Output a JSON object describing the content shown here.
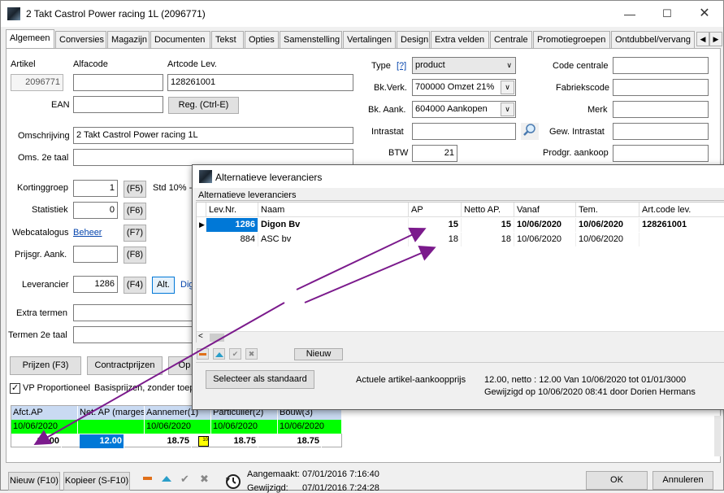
{
  "window": {
    "title": "2 Takt Castrol Power racing 1L (2096771)"
  },
  "tabs": [
    "Algemeen",
    "Conversies",
    "Magazijn",
    "Documenten",
    "Tekst",
    "Opties",
    "Samenstelling",
    "Vertalingen",
    "Design",
    "Extra velden",
    "Centrale",
    "Promotiegroepen",
    "Ontdubbel/vervang"
  ],
  "form": {
    "artikel_label": "Artikel",
    "artikel_value": "2096771",
    "alfacode_label": "Alfacode",
    "artcode_label": "Artcode Lev.",
    "artcode_value": "128261001",
    "ean_label": "EAN",
    "reg_button": "Reg. (Ctrl-E)",
    "omschrijving_label": "Omschrijving",
    "omschrijving_value": "2 Takt Castrol Power racing 1L",
    "oms2_label": "Oms. 2e taal",
    "type_label": "Type",
    "type_help": "[?]",
    "type_value": "product",
    "bkverk_label": "Bk.Verk.",
    "bkverk_value": "700000 Omzet 21%",
    "bkaank_label": "Bk. Aank.",
    "bkaank_value": "604000 Aankopen",
    "intrastat_label": "Intrastat",
    "btw_label": "BTW",
    "btw_value": "21",
    "code_centrale_label": "Code centrale",
    "fabriekscode_label": "Fabriekscode",
    "merk_label": "Merk",
    "gew_intrastat_label": "Gew. Intrastat",
    "prodgr_label": "Prodgr. aankoop",
    "kortinggroep_label": "Kortinggroep",
    "kortinggroep_value": "1",
    "f5": "(F5)",
    "std_text": "Std 10% -",
    "statistiek_label": "Statistiek",
    "statistiek_value": "0",
    "f6": "(F6)",
    "webcatalogus_label": "Webcatalogus",
    "beheer_link": "Beheer",
    "f7": "(F7)",
    "prijsgr_label": "Prijsgr. Aank.",
    "f8": "(F8)",
    "leverancier_label": "Leverancier",
    "leverancier_value": "1286",
    "f4": "(F4)",
    "alt_button": "Alt.",
    "leverancier_name": "Dig",
    "extra_termen_label": "Extra termen",
    "termen2_label": "Termen 2e taal",
    "prijzen_button": "Prijzen (F3)",
    "contractprijzen_button": "Contractprijzen",
    "op_button": "Op",
    "vp_checkbox": "VP Proportioneel",
    "basisprijzen_text": "Basisprijzen, zonder toep"
  },
  "price_grid": {
    "headers": [
      "Afct.AP",
      "Net. AP (marges)",
      "Aannemer(1)",
      "Particulier(2)",
      "Bouw(3)"
    ],
    "dates": [
      "10/06/2020",
      "",
      "10/06/2020",
      "10/06/2020",
      "10/06/2020"
    ],
    "values": [
      "12.00",
      "12.00",
      "18.75",
      "18.75",
      "18.75"
    ],
    "marker": "10"
  },
  "bottom": {
    "nieuw_button": "Nieuw (F10)",
    "kopieer_button": "Kopieer (S-F10)",
    "aangemaakt_label": "Aangemaakt:",
    "aangemaakt_value": "07/01/2016 7:16:40",
    "gewijzigd_label": "Gewijzigd:",
    "gewijzigd_value": "07/01/2016 7:24:28",
    "ok_button": "OK",
    "annuleren_button": "Annuleren"
  },
  "dialog": {
    "title": "Alternatieve leveranciers",
    "section_label": "Alternatieve leveranciers",
    "columns": [
      "Lev.Nr.",
      "Naam",
      "AP",
      "Netto AP.",
      "Vanaf",
      "Tem.",
      "Art.code lev."
    ],
    "rows": [
      {
        "levnr": "1286",
        "naam": "Digon Bv",
        "ap": "15",
        "netto": "15",
        "vanaf": "10/06/2020",
        "tem": "10/06/2020",
        "artcode": "128261001"
      },
      {
        "levnr": "884",
        "naam": "ASC bv",
        "ap": "18",
        "netto": "18",
        "vanaf": "10/06/2020",
        "tem": "10/06/2020",
        "artcode": ""
      }
    ],
    "nieuw_button": "Nieuw",
    "selecteer_button": "Selecteer als standaard",
    "actuele_label": "Actuele artikel-aankoopprijs",
    "actuele_value": "12.00, netto : 12.00  Van 10/06/2020 tot 01/01/3000",
    "gewijzigd_text": "Gewijzigd op 10/06/2020 08:41 door Dorien Hermans"
  },
  "colors": {
    "green": "#00ff00",
    "selected_blue": "#0078d7",
    "annotation": "#7b1a8c"
  }
}
